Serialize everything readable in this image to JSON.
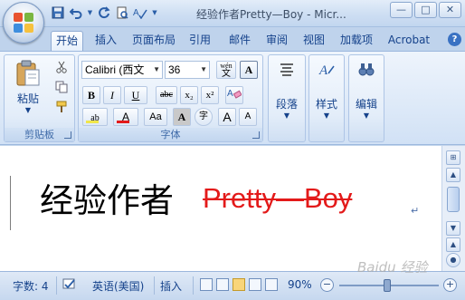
{
  "window": {
    "title": "经验作者Pretty—Boy - Micr...",
    "controls": {
      "minimize": "—",
      "maximize": "□",
      "close": "✕"
    }
  },
  "qat": {
    "icons": [
      "save-icon",
      "undo-icon",
      "redo-icon",
      "print-preview-icon",
      "spelling-icon",
      "customize-qat-icon"
    ]
  },
  "tabs": [
    "开始",
    "插入",
    "页面布局",
    "引用",
    "邮件",
    "审阅",
    "视图",
    "加载项",
    "Acrobat"
  ],
  "ribbon": {
    "clipboard": {
      "label": "剪贴板",
      "paste": "粘贴"
    },
    "font": {
      "label": "字体",
      "font_name": "Calibri (西文",
      "font_size": "36",
      "phonetic": "wén",
      "buttons": {
        "bold": "B",
        "italic": "I",
        "underline": "U",
        "strikethrough": "abc",
        "subscript": "x₂",
        "superscript": "x²",
        "case": "Aa",
        "grow": "A",
        "shrink": "A",
        "char_border": "A",
        "char_shade": "A",
        "enclose": "字"
      }
    },
    "paragraph": {
      "label": "段落"
    },
    "styles": {
      "label": "样式"
    },
    "editing": {
      "label": "编辑"
    }
  },
  "document": {
    "text_black": "经验作者",
    "text_red": "Pretty—Boy",
    "paragraph_mark": "↵"
  },
  "status": {
    "word_count": "字数: 4",
    "language": "英语(美国)",
    "mode": "插入",
    "zoom": "90%"
  },
  "watermark": "Baidu 经验",
  "colors": {
    "accent": "#15428b",
    "red_text": "#e31a1a",
    "highlight": "#f0e64a"
  }
}
